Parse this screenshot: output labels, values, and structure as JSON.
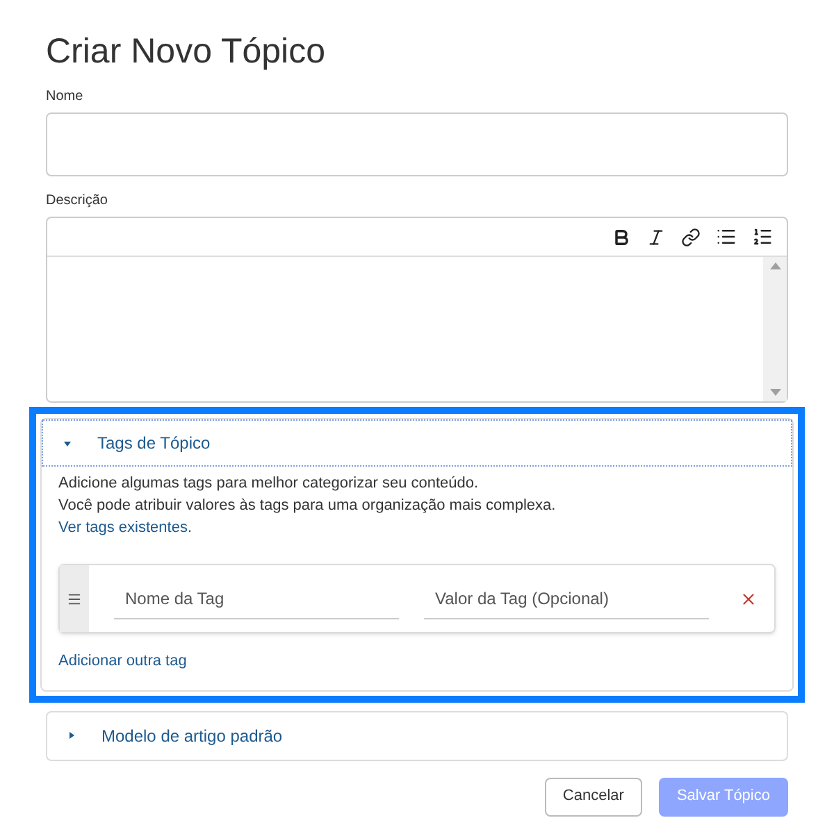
{
  "title": "Criar Novo Tópico",
  "name_field": {
    "label": "Nome"
  },
  "description_field": {
    "label": "Descrição"
  },
  "sections": [
    {
      "title": "Tags de Tópico",
      "expanded": true,
      "highlighted": true,
      "lines": [
        "Adicione algumas tags para melhor categorizar seu conteúdo.",
        "Você pode atribuir valores às tags para uma organização mais complexa."
      ],
      "link": "Ver tags existentes.",
      "tags": [
        {
          "name_placeholder": "Nome da Tag",
          "value_placeholder": "Valor da Tag (Opcional)"
        }
      ],
      "add_label": "Adicionar outra tag"
    },
    {
      "title": "Modelo de artigo padrão",
      "expanded": false,
      "highlighted": false
    }
  ],
  "buttons": [
    {
      "label": "Cancelar",
      "kind": "secondary",
      "disabled": false
    },
    {
      "label": "Salvar Tópico",
      "kind": "primary",
      "disabled": true
    }
  ]
}
